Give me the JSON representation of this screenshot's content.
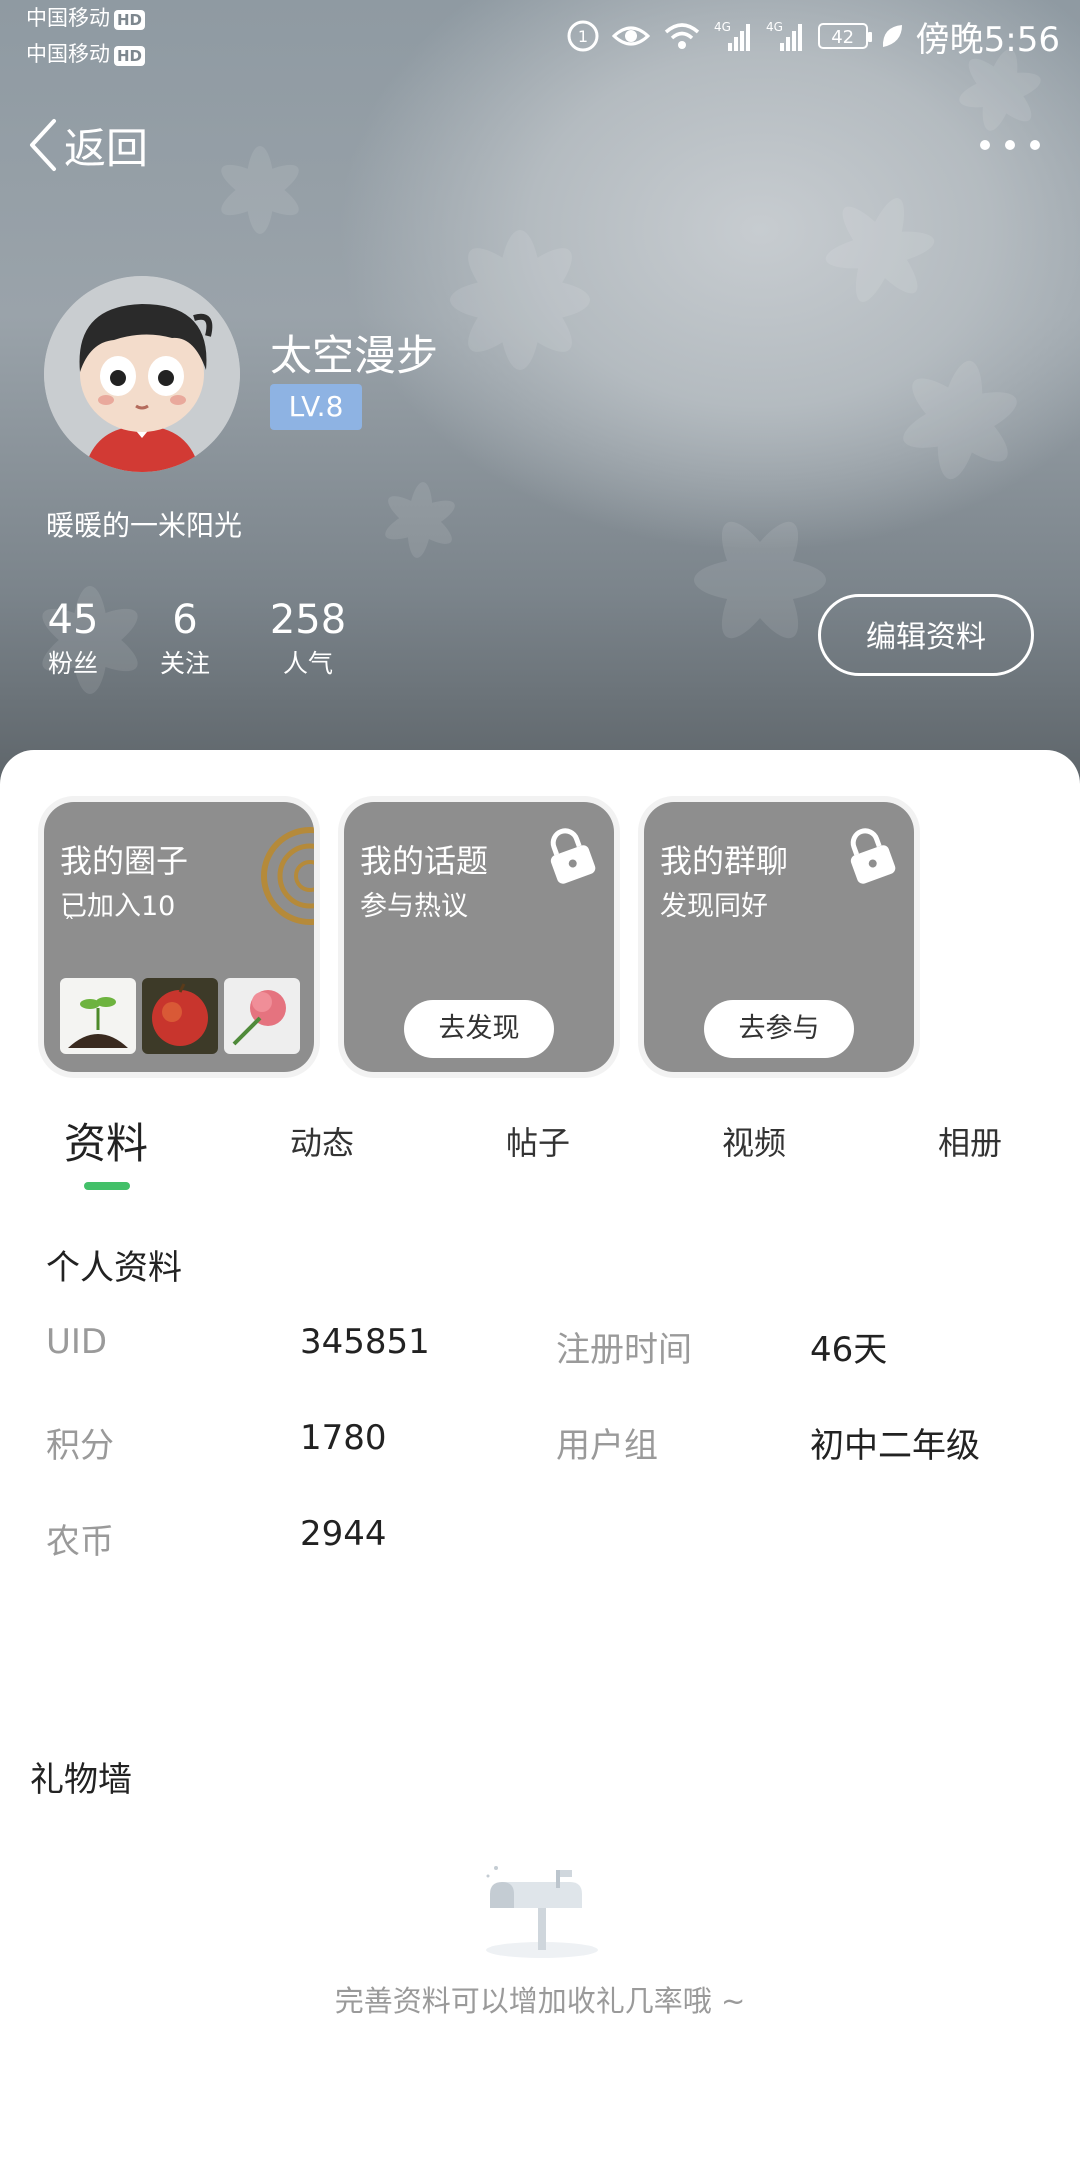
{
  "status_bar": {
    "carrier1": "中国移动",
    "carrier2": "中国移动",
    "hd": "HD",
    "battery": "42",
    "time": "傍晚5:56"
  },
  "nav": {
    "back_label": "返回"
  },
  "profile": {
    "username": "太空漫步",
    "level": "LV.8",
    "signature": "暖暖的一米阳光",
    "stats": [
      {
        "value": "45",
        "label": "粉丝"
      },
      {
        "value": "6",
        "label": "关注"
      },
      {
        "value": "258",
        "label": "人气"
      }
    ],
    "edit_label": "编辑资料"
  },
  "cards": [
    {
      "title": "我的圈子",
      "subtitle": "已加入10",
      "extra": "ˆ"
    },
    {
      "title": "我的话题",
      "subtitle": "参与热议",
      "button": "去发现"
    },
    {
      "title": "我的群聊",
      "subtitle": "发现同好",
      "button": "去参与"
    }
  ],
  "tabs": [
    "资料",
    "动态",
    "帖子",
    "视频",
    "相册"
  ],
  "info": {
    "title": "个人资料",
    "rows": [
      {
        "label": "UID",
        "value": "345851"
      },
      {
        "label": "注册时间",
        "value": "46天"
      },
      {
        "label": "积分",
        "value": "1780"
      },
      {
        "label": "用户组",
        "value": "初中二年级"
      },
      {
        "label": "农币",
        "value": "2944"
      }
    ]
  },
  "gift_wall": {
    "title": "礼物墙",
    "empty_text": "完善资料可以增加收礼几率哦 ~"
  },
  "colors": {
    "accent_green": "#43c069",
    "level_badge": "#8eb3e3",
    "card_bg": "#8e8e8e"
  }
}
